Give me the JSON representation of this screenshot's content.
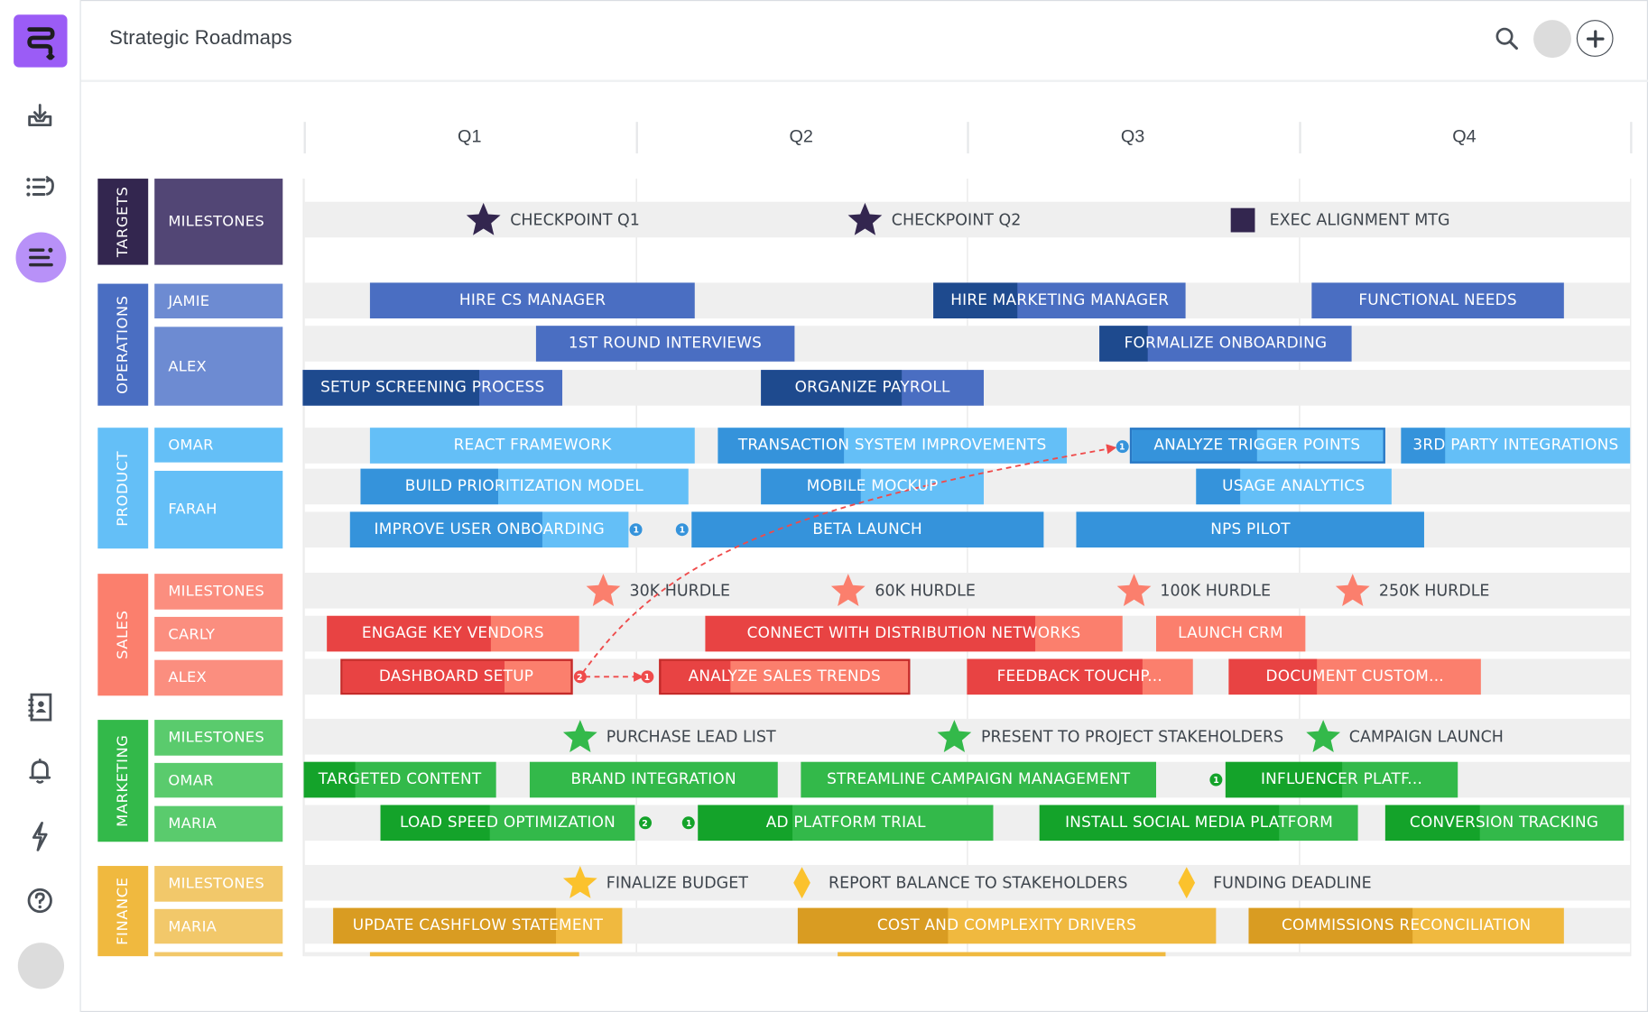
{
  "app": {
    "title": "Strategic Roadmaps",
    "logo_icon": "roadmap-logo-icon",
    "header_icons": [
      "search-icon",
      "user-avatar",
      "plus-icon"
    ],
    "sidebar_top_icons": [
      "import-icon",
      "list-reorder-icon",
      "roadmap-view-icon"
    ],
    "sidebar_bottom_icons": [
      "contacts-icon",
      "bell-icon",
      "lightning-icon",
      "help-icon",
      "user-avatar"
    ]
  },
  "timeline": {
    "quarters": [
      "Q1",
      "Q2",
      "Q3",
      "Q4"
    ]
  },
  "colors": {
    "targets": {
      "group": "#33264f",
      "label": "#524675",
      "marker": "#33264f"
    },
    "operations": {
      "group": "#4a6ec2",
      "label": "#6d8bd2",
      "bar": "#4a6ec2",
      "done": "#1e4a8e"
    },
    "product": {
      "group": "#64bff7",
      "label": "#64bff7",
      "bar": "#64bff7",
      "done": "#3593db"
    },
    "sales": {
      "group": "#fb7f6d",
      "label": "#fb8e7f",
      "bar": "#fb7f6d",
      "done": "#e84343",
      "marker": "#fb7f6d"
    },
    "marketing": {
      "group": "#33b94a",
      "label": "#5acb6d",
      "bar": "#33b94a",
      "done": "#14a32a",
      "marker": "#33b94a"
    },
    "finance": {
      "group": "#f0b93f",
      "label": "#f2c86a",
      "bar": "#f0b93f",
      "done": "#d99c22",
      "marker": "#fbc22d"
    },
    "dependency": "#ef4b4b"
  },
  "groups": [
    {
      "key": "targets",
      "name": "TARGETS",
      "rows": [
        {
          "name": "MILESTONES",
          "type": "milestones",
          "items": [
            {
              "label": "CHECKPOINT Q1",
              "at": 0.54,
              "shape": "star"
            },
            {
              "label": "CHECKPOINT Q2",
              "at": 1.69,
              "shape": "star"
            },
            {
              "label": "EXEC ALIGNMENT MTG",
              "at": 2.83,
              "shape": "square"
            }
          ]
        }
      ]
    },
    {
      "key": "operations",
      "name": "OPERATIONS",
      "rows": [
        {
          "name": "JAMIE",
          "lanes": [
            [
              {
                "label": "HIRE CS MANAGER",
                "start": 0.2,
                "end": 1.18,
                "progress": 0
              },
              {
                "label": "HIRE MARKETING MANAGER",
                "start": 1.9,
                "end": 2.66,
                "progress": 0.33
              },
              {
                "label": "FUNCTIONAL NEEDS",
                "start": 3.04,
                "end": 3.8,
                "progress": 0
              }
            ]
          ]
        },
        {
          "name": "ALEX",
          "lanes": [
            [
              {
                "label": "1ST ROUND INTERVIEWS",
                "start": 0.7,
                "end": 1.48,
                "progress": 0
              },
              {
                "label": "FORMALIZE ONBOARDING",
                "start": 2.4,
                "end": 3.16,
                "progress": 0.19
              }
            ],
            [
              {
                "label": "SETUP SCREENING PROCESS",
                "start": -0.01,
                "end": 0.78,
                "progress": 0.68
              },
              {
                "label": "ORGANIZE PAYROLL",
                "start": 1.38,
                "end": 2.05,
                "progress": 0.63
              }
            ]
          ]
        }
      ]
    },
    {
      "key": "product",
      "name": "PRODUCT",
      "rows": [
        {
          "name": "OMAR",
          "lanes": [
            [
              {
                "label": "REACT FRAMEWORK",
                "start": 0.2,
                "end": 1.18,
                "progress": 0
              },
              {
                "label": "TRANSACTION SYSTEM IMPROVEMENTS",
                "start": 1.25,
                "end": 2.3,
                "progress": 0.36
              },
              {
                "label": "ANALYZE TRIGGER POINTS",
                "start": 2.49,
                "end": 3.26,
                "progress": 0.5,
                "outlined": true
              },
              {
                "label": "3RD PARTY INTEGRATIONS",
                "start": 3.31,
                "end": 4.0,
                "progress": 0.19
              }
            ]
          ]
        },
        {
          "name": "FARAH",
          "lanes": [
            [
              {
                "label": "BUILD PRIORITIZATION MODEL",
                "start": 0.17,
                "end": 1.16,
                "progress": 0.42
              },
              {
                "label": "MOBILE MOCKUP",
                "start": 1.38,
                "end": 2.05,
                "progress": 0.45
              },
              {
                "label": "USAGE ANALYTICS",
                "start": 2.69,
                "end": 3.28,
                "progress": 0.23
              }
            ],
            [
              {
                "label": "IMPROVE USER ONBOARDING",
                "start": 0.14,
                "end": 0.98,
                "progress": 0.69
              },
              {
                "label": "BETA LAUNCH",
                "start": 1.17,
                "end": 2.23,
                "progress": 1
              },
              {
                "label": "NPS PILOT",
                "start": 2.33,
                "end": 3.38,
                "progress": 1
              }
            ]
          ]
        }
      ]
    },
    {
      "key": "sales",
      "name": "SALES",
      "rows": [
        {
          "name": "MILESTONES",
          "type": "milestones",
          "items": [
            {
              "label": "30K HURDLE",
              "at": 0.9,
              "shape": "star"
            },
            {
              "label": "60K HURDLE",
              "at": 1.64,
              "shape": "star"
            },
            {
              "label": "100K HURDLE",
              "at": 2.5,
              "shape": "star"
            },
            {
              "label": "250K HURDLE",
              "at": 3.16,
              "shape": "star"
            }
          ]
        },
        {
          "name": "CARLY",
          "lanes": [
            [
              {
                "label": "ENGAGE KEY VENDORS",
                "start": 0.07,
                "end": 0.83,
                "progress": 0.65
              },
              {
                "label": "CONNECT WITH DISTRIBUTION NETWORKS",
                "start": 1.21,
                "end": 2.47,
                "progress": 0.79
              },
              {
                "label": "LAUNCH CRM",
                "start": 2.57,
                "end": 3.02,
                "progress": 0
              }
            ]
          ]
        },
        {
          "name": "ALEX",
          "lanes": [
            [
              {
                "label": "DASHBOARD SETUP",
                "start": 0.11,
                "end": 0.81,
                "progress": 0.71,
                "outlined": true
              },
              {
                "label": "ANALYZE SALES TRENDS",
                "start": 1.07,
                "end": 1.83,
                "progress": 0.28,
                "outlined": true
              },
              {
                "label": "FEEDBACK TOUCHP...",
                "start": 2.0,
                "end": 2.68,
                "progress": 0.78
              },
              {
                "label": "DOCUMENT CUSTOM...",
                "start": 2.79,
                "end": 3.55,
                "progress": 0.35
              }
            ]
          ]
        }
      ]
    },
    {
      "key": "marketing",
      "name": "MARKETING",
      "rows": [
        {
          "name": "MILESTONES",
          "type": "milestones",
          "items": [
            {
              "label": "PURCHASE LEAD LIST",
              "at": 0.83,
              "shape": "star"
            },
            {
              "label": "PRESENT TO PROJECT STAKEHOLDERS",
              "at": 1.96,
              "shape": "star"
            },
            {
              "label": "CAMPAIGN LAUNCH",
              "at": 3.07,
              "shape": "star"
            }
          ]
        },
        {
          "name": "OMAR",
          "lanes": [
            [
              {
                "label": "TARGETED CONTENT",
                "start": 0.0,
                "end": 0.58,
                "progress": 0.27
              },
              {
                "label": "BRAND INTEGRATION",
                "start": 0.68,
                "end": 1.43,
                "progress": 0
              },
              {
                "label": "STREAMLINE CAMPAIGN MANAGEMENT",
                "start": 1.5,
                "end": 2.57,
                "progress": 0
              },
              {
                "label": "INFLUENCER PLATF...",
                "start": 2.78,
                "end": 3.48,
                "progress": 0.5
              }
            ]
          ]
        },
        {
          "name": "MARIA",
          "lanes": [
            [
              {
                "label": "LOAD SPEED OPTIMIZATION",
                "start": 0.23,
                "end": 1.0,
                "progress": 0.43
              },
              {
                "label": "AD PLATFORM TRIAL",
                "start": 1.19,
                "end": 2.08,
                "progress": 0.32
              },
              {
                "label": "INSTALL SOCIAL MEDIA PLATFORM",
                "start": 2.22,
                "end": 3.18,
                "progress": 0.75
              },
              {
                "label": "CONVERSION TRACKING",
                "start": 3.26,
                "end": 3.98,
                "progress": 0.4
              }
            ]
          ]
        }
      ]
    },
    {
      "key": "finance",
      "name": "FINANCE",
      "rows": [
        {
          "name": "MILESTONES",
          "type": "milestones",
          "items": [
            {
              "label": "FINALIZE BUDGET",
              "at": 0.83,
              "shape": "star"
            },
            {
              "label": "REPORT BALANCE TO STAKEHOLDERS",
              "at": 1.5,
              "shape": "diamond"
            },
            {
              "label": "FUNDING DEADLINE",
              "at": 2.66,
              "shape": "diamond"
            }
          ]
        },
        {
          "name": "MARIA",
          "lanes": [
            [
              {
                "label": "UPDATE CASHFLOW STATEMENT",
                "start": 0.09,
                "end": 0.96,
                "progress": 0.77
              },
              {
                "label": "COST AND COMPLEXITY DRIVERS",
                "start": 1.49,
                "end": 2.75,
                "progress": 0.36
              },
              {
                "label": "COMMISSIONS RECONCILIATION",
                "start": 2.85,
                "end": 3.8,
                "progress": 0.52
              }
            ]
          ]
        },
        {
          "name": "",
          "lanes": [
            [
              {
                "label": "",
                "start": 0.2,
                "end": 0.83,
                "progress": 0
              },
              {
                "label": "",
                "start": 1.61,
                "end": 2.6,
                "progress": 0
              }
            ]
          ]
        }
      ]
    }
  ],
  "dependencies": [
    {
      "from": "DASHBOARD SETUP",
      "to": "ANALYZE TRIGGER POINTS",
      "from_badge": "2",
      "to_badge": "1"
    },
    {
      "from": "DASHBOARD SETUP",
      "to": "ANALYZE SALES TRENDS",
      "from_badge": "2",
      "to_badge": "1"
    }
  ],
  "dependency_badges": [
    {
      "row": "product-farah-2",
      "after": "IMPROVE USER ONBOARDING",
      "text": "1"
    },
    {
      "row": "product-farah-2",
      "before": "BETA LAUNCH",
      "text": "1"
    },
    {
      "row": "marketing-omar",
      "before": "INFLUENCER PLATF...",
      "text": "1"
    },
    {
      "row": "marketing-maria",
      "after": "LOAD SPEED OPTIMIZATION",
      "text": "2"
    },
    {
      "row": "marketing-maria",
      "before": "AD PLATFORM TRIAL",
      "text": "1"
    }
  ]
}
